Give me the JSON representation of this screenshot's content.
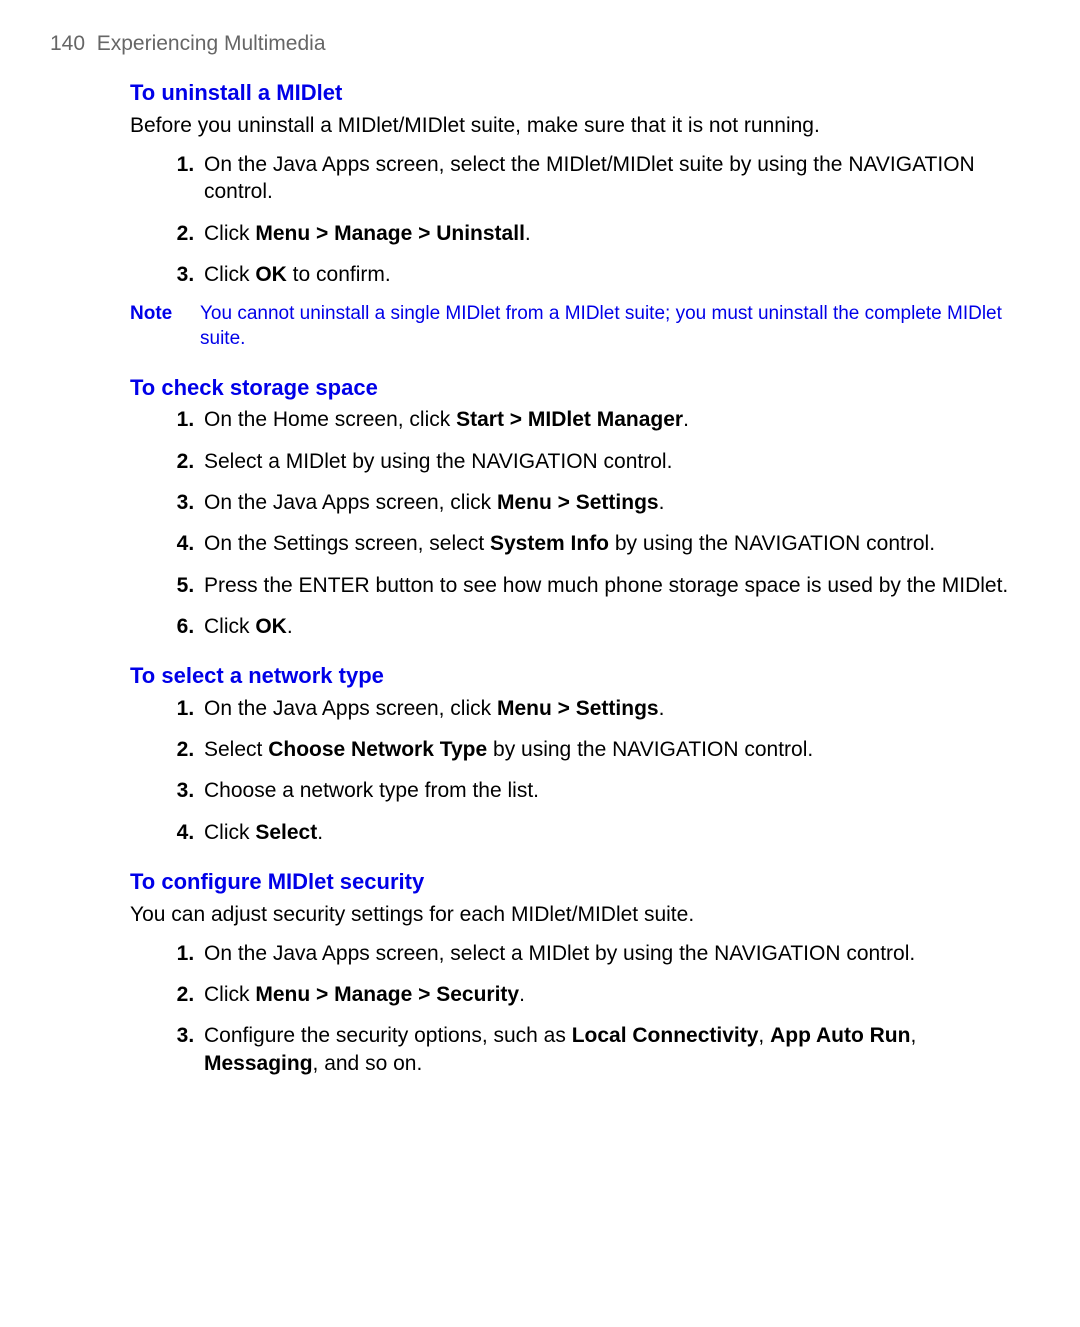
{
  "header": {
    "page_no": "140",
    "chapter": "Experiencing Multimedia"
  },
  "sections": {
    "uninstall": {
      "title": "To uninstall a MIDlet",
      "intro": "Before you uninstall a MIDlet/MIDlet suite, make sure that it is not running.",
      "steps": {
        "s1": "On the Java Apps screen, select the MIDlet/MIDlet suite by using the NAVIGATION control.",
        "s2_a": "Click ",
        "s2_b": "Menu > Manage > Uninstall",
        "s2_c": ".",
        "s3_a": "Click ",
        "s3_b": "OK",
        "s3_c": " to confirm."
      },
      "note_label": "Note",
      "note_text": "You cannot uninstall a single MIDlet from a MIDlet suite; you must uninstall the complete MIDlet suite."
    },
    "storage": {
      "title": "To check storage space",
      "steps": {
        "s1_a": "On the Home screen, click ",
        "s1_b": "Start > MIDlet Manager",
        "s1_c": ".",
        "s2": "Select a MIDlet by using the NAVIGATION control.",
        "s3_a": "On the Java Apps screen, click ",
        "s3_b": "Menu > Settings",
        "s3_c": ".",
        "s4_a": "On the Settings screen, select ",
        "s4_b": "System Info",
        "s4_c": " by using the NAVIGATION control.",
        "s5": "Press the ENTER button to see how much phone storage space is used by the MIDlet.",
        "s6_a": "Click ",
        "s6_b": "OK",
        "s6_c": "."
      }
    },
    "network": {
      "title": "To select a network type",
      "steps": {
        "s1_a": "On the Java Apps screen, click ",
        "s1_b": "Menu > Settings",
        "s1_c": ".",
        "s2_a": "Select ",
        "s2_b": "Choose Network Type",
        "s2_c": " by using the NAVIGATION control.",
        "s3": "Choose a network type from the list.",
        "s4_a": "Click ",
        "s4_b": "Select",
        "s4_c": "."
      }
    },
    "security": {
      "title": "To configure MIDlet security",
      "intro": "You can adjust security settings for each MIDlet/MIDlet suite.",
      "steps": {
        "s1": "On the Java Apps screen, select a MIDlet by using the NAVIGATION control.",
        "s2_a": "Click ",
        "s2_b": "Menu > Manage > Security",
        "s2_c": ".",
        "s3_a": "Configure the security options, such as ",
        "s3_b": "Local Connectivity",
        "s3_c": ", ",
        "s3_d": "App Auto Run",
        "s3_e": ", ",
        "s3_f": "Messaging",
        "s3_g": ", and so on."
      }
    }
  }
}
